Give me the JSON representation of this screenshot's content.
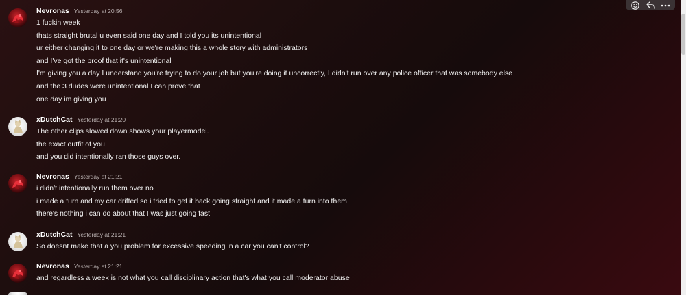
{
  "groups": [
    {
      "user": "Nevronas",
      "time": "Yesterday at 20:56",
      "lines": [
        "1 fuckin week",
        "thats straight brutal u even said one day and I told you its unintentional",
        "ur either changing it to one day or we're making this a whole story with administrators",
        "and I've got the proof that it's unintentional",
        "I'm giving you a day I understand you're trying to do your job but you're doing it uncorrectly, I didn't run over any police officer that was somebody else",
        "and the 3 dudes were unintentional I can prove that",
        "one day im giving you"
      ]
    },
    {
      "user": "xDutchCat",
      "time": "Yesterday at 21:20",
      "lines": [
        "The other clips slowed down shows your playermodel.",
        "the exact outfit of you",
        "and you did intentionally ran those guys over."
      ]
    },
    {
      "user": "Nevronas",
      "time": "Yesterday at 21:21",
      "lines": [
        "i didn't intentionally run them over no",
        "i made a turn and my car drifted so i tried to get it back going straight and it made a turn into them",
        "there's nothing i can do about that I was just going fast"
      ]
    },
    {
      "user": "xDutchCat",
      "time": "Yesterday at 21:21",
      "lines": [
        "So doesnt make that a you problem for excessive speeding in a car you can't control?"
      ]
    },
    {
      "user": "Nevronas",
      "time": "Yesterday at 21:21",
      "lines": [
        "and regardless a week is not what you call disciplinary action that's what you call moderator abuse"
      ]
    }
  ],
  "actions": {
    "icons": [
      "emoji-reaction-icon",
      "reply-icon",
      "more-options-icon"
    ]
  }
}
